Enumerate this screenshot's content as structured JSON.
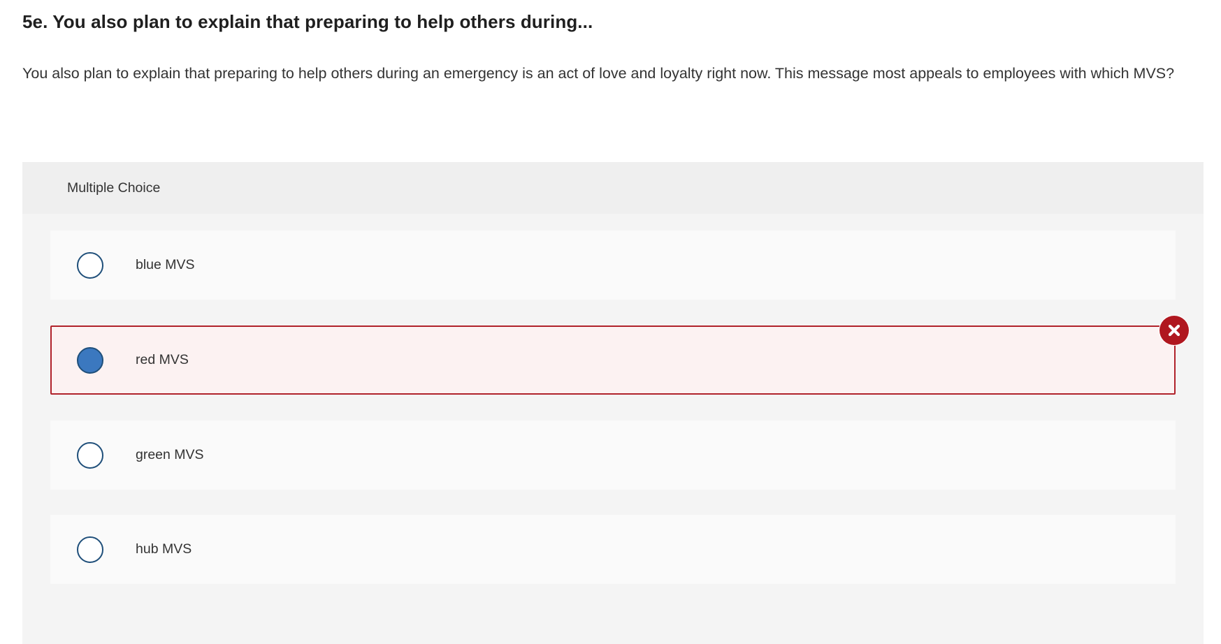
{
  "question": {
    "title": "5e. You also plan to explain that preparing to help others during...",
    "prompt": "You also plan to explain that preparing to help others during an emergency is an act of love and loyalty right now. This message most appeals to employees with which MVS?"
  },
  "panel": {
    "header": "Multiple Choice",
    "choices": [
      {
        "label": "blue MVS",
        "selected": false
      },
      {
        "label": "red MVS",
        "selected": true,
        "status": "incorrect",
        "status_icon": "x-circle-icon"
      },
      {
        "label": "green MVS",
        "selected": false
      },
      {
        "label": "hub MVS",
        "selected": false
      }
    ]
  },
  "colors": {
    "incorrect": "#b0171f",
    "selected_radio": "#3b78bf",
    "radio_border": "#1f4f7a"
  }
}
